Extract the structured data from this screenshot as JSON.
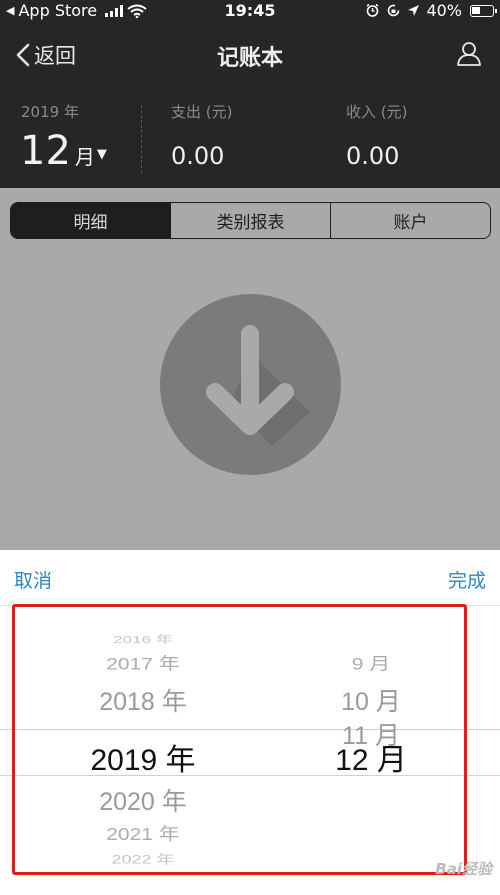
{
  "status_bar": {
    "back_app": "App Store",
    "time": "19:45",
    "battery_percent": "40%",
    "battery_level": 0.4
  },
  "nav": {
    "back_label": "返回",
    "title": "记账本",
    "icons": {
      "back": "chevron-left-icon",
      "user": "user-icon"
    }
  },
  "summary": {
    "year": "2019 年",
    "month_number": "12",
    "month_unit": "月",
    "expense_label": "支出 (元)",
    "expense_value": "0.00",
    "income_label": "收入 (元)",
    "income_value": "0.00"
  },
  "tabs": [
    {
      "label": "明细",
      "active": true
    },
    {
      "label": "类别报表",
      "active": false
    },
    {
      "label": "账户",
      "active": false
    }
  ],
  "picker": {
    "cancel_label": "取消",
    "done_label": "完成",
    "years": [
      "2016 年",
      "2017 年",
      "2018 年",
      "2019 年",
      "2020 年",
      "2021 年",
      "2022 年"
    ],
    "months": [
      "9 月",
      "10 月",
      "11 月",
      "12 月"
    ],
    "selected_year": "2019 年",
    "selected_month": "12 月"
  },
  "watermark": "Bai经验",
  "colors": {
    "accent": "#2f86c6",
    "header_bg": "#262626",
    "highlight_border": "#e21b1b"
  }
}
